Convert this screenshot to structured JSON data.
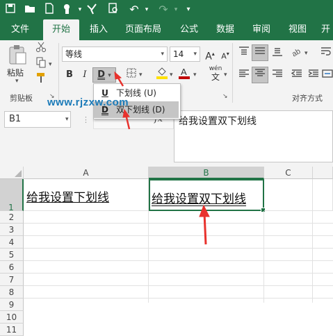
{
  "quick_access": {
    "icons": [
      "save-icon",
      "folder-icon",
      "new-file-icon",
      "touch-mode-icon",
      "format-painter-icon",
      "print-preview-icon",
      "undo-icon",
      "redo-icon",
      "customize-icon"
    ]
  },
  "tabs": [
    "文件",
    "开始",
    "插入",
    "页面布局",
    "公式",
    "数据",
    "审阅",
    "视图",
    "开"
  ],
  "active_tab": "开始",
  "ribbon": {
    "paste_label": "粘贴",
    "clipboard_label": "剪贴板",
    "font_name": "等线",
    "font_size": "14",
    "bold": "B",
    "italic": "I",
    "underline": "D",
    "wen_label": "wén",
    "wen_sub": "文",
    "align_label": "对齐方式"
  },
  "underline_menu": {
    "items": [
      {
        "icon": "U",
        "label": "下划线 (U)"
      },
      {
        "icon": "D",
        "label": "双下划线 (D)"
      }
    ]
  },
  "watermark": "www.rjzxw.com",
  "name_box": "B1",
  "formula_text": "给我设置双下划线",
  "fx_label": "fx",
  "columns": [
    "A",
    "B",
    "C"
  ],
  "rows": [
    "1",
    "2",
    "3",
    "4",
    "5",
    "6",
    "7",
    "8",
    "9",
    "10",
    "11"
  ],
  "cells": {
    "A1": "给我设置下划线",
    "B1": "给我设置双下划线"
  },
  "colors": {
    "excel_green": "#217346",
    "selection_green": "#217346",
    "arrow_red": "#e8322d",
    "watermark_blue": "#1a7ab8",
    "font_color_red": "#c00000",
    "highlight_yellow": "#ffe100"
  }
}
